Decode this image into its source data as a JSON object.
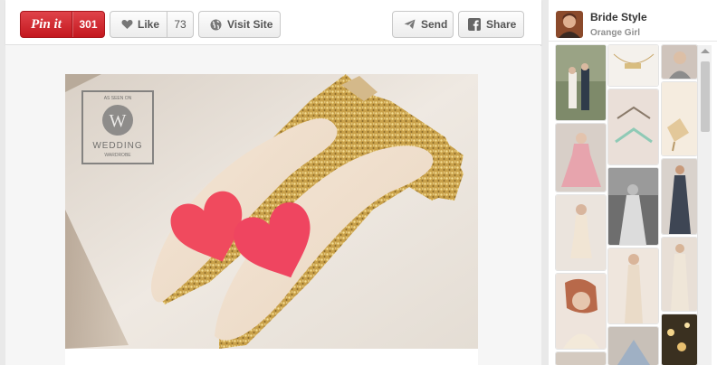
{
  "toolbar": {
    "pin_label": "Pin it",
    "pin_count": "301",
    "like_label": "Like",
    "like_count": "73",
    "visit_label": "Visit Site",
    "send_label": "Send",
    "share_label": "Share"
  },
  "image": {
    "watermark_top": "AS SEEN ON",
    "watermark_letter": "W",
    "watermark_brand": "WEDDING",
    "watermark_sub": "WARDROBE"
  },
  "board": {
    "title": "Bride Style",
    "owner": "Orange Girl"
  },
  "icons": {
    "like": "heart-icon",
    "visit": "globe-icon",
    "send": "paper-plane-icon",
    "share": "facebook-icon"
  },
  "colors": {
    "pin_red": "#cb2027",
    "heart_pink": "#f04a5e",
    "glitter_gold": "#c9a14a"
  }
}
